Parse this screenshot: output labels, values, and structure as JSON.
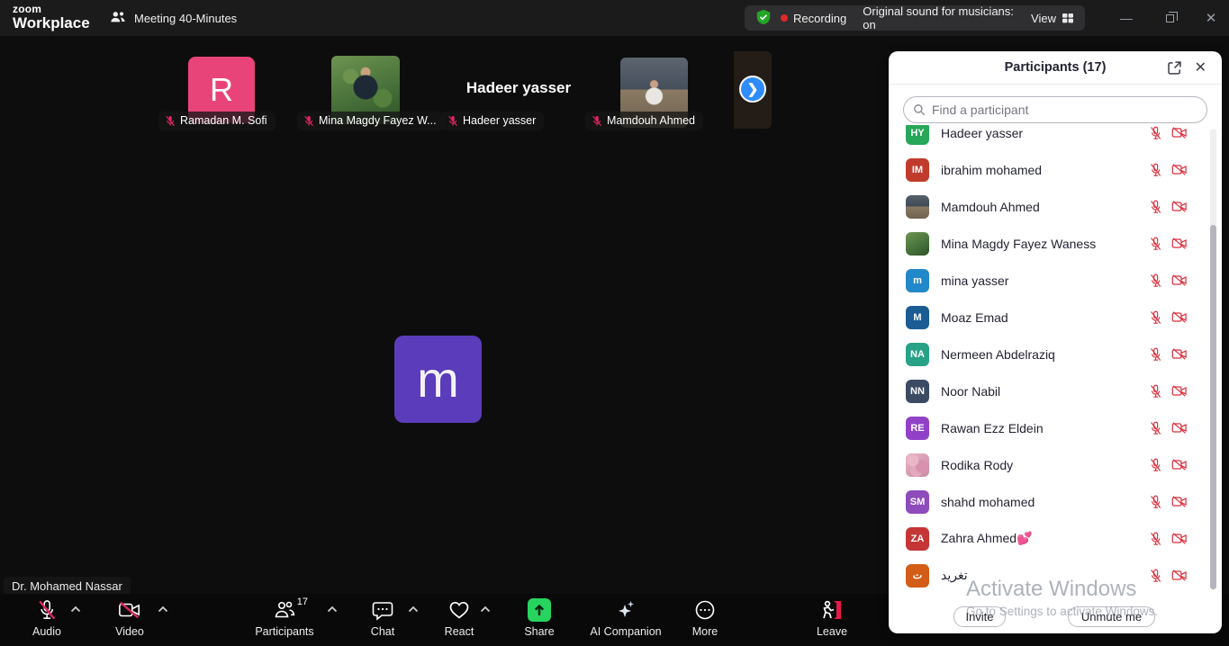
{
  "titlebar": {
    "logo_line1": "zoom",
    "logo_line2": "Workplace",
    "meeting_title": "Meeting 40-Minutes",
    "recording_label": "Recording",
    "original_sound": "Original sound for musicians: on",
    "view_label": "View"
  },
  "stage": {
    "tiles": [
      {
        "label": "Ramadan M. Sofi",
        "initial": "R",
        "avatar_color": "#e9447a"
      },
      {
        "label": "Mina Magdy Fayez W..."
      },
      {
        "label": "Hadeer yasser",
        "display_name": "Hadeer yasser"
      },
      {
        "label": "Mamdouh Ahmed"
      }
    ],
    "active_speaker": {
      "initial": "m",
      "avatar_color": "#5b3cba",
      "name_label": "Dr. Mohamed Nassar"
    }
  },
  "toolbar": {
    "audio": "Audio",
    "video": "Video",
    "participants": "Participants",
    "participants_count": "17",
    "chat": "Chat",
    "react": "React",
    "share": "Share",
    "ai_companion": "AI Companion",
    "more": "More",
    "leave": "Leave",
    "share_color": "#26d45f",
    "mute_slash_color": "#e0265e"
  },
  "panel": {
    "title": "Participants (17)",
    "search_placeholder": "Find a participant",
    "muted_icon_color": "#d92f3c",
    "participants": [
      {
        "name": "Hadeer yasser",
        "avatar": "initials",
        "initials": "HY",
        "color": "#27a759"
      },
      {
        "name": "ibrahim mohamed",
        "avatar": "initials",
        "initials": "IM",
        "color": "#c13b2c"
      },
      {
        "name": "Mamdouh Ahmed",
        "avatar": "photo-classroom-sm"
      },
      {
        "name": "Mina Magdy Fayez Waness",
        "avatar": "photo-greenery-sm"
      },
      {
        "name": "mina yasser",
        "avatar": "initials",
        "initials": "m",
        "color": "#2188c9"
      },
      {
        "name": "Moaz Emad",
        "avatar": "initials",
        "initials": "M",
        "color": "#1b5c94"
      },
      {
        "name": "Nermeen Abdelraziq",
        "avatar": "initials",
        "initials": "NA",
        "color": "#27a287"
      },
      {
        "name": "Noor Nabil",
        "avatar": "initials",
        "initials": "NN",
        "color": "#3c4a63"
      },
      {
        "name": "Rawan Ezz Eldein",
        "avatar": "initials",
        "initials": "RE",
        "color": "#9141c8"
      },
      {
        "name": "Rodika Rody",
        "avatar": "photo-flowers-sm"
      },
      {
        "name": "shahd mohamed",
        "avatar": "initials",
        "initials": "SM",
        "color": "#8d4bbb"
      },
      {
        "name": "Zahra Ahmed💕",
        "avatar": "initials",
        "initials": "ZA",
        "color": "#c63535"
      },
      {
        "name": "تغريد",
        "avatar": "initials",
        "initials": "ت",
        "color": "#d35d17"
      }
    ],
    "invite_label": "Invite",
    "unmute_label": "Unmute me"
  },
  "watermark": {
    "line1": "Activate Windows",
    "line2": "Go to Settings to activate Windows."
  }
}
